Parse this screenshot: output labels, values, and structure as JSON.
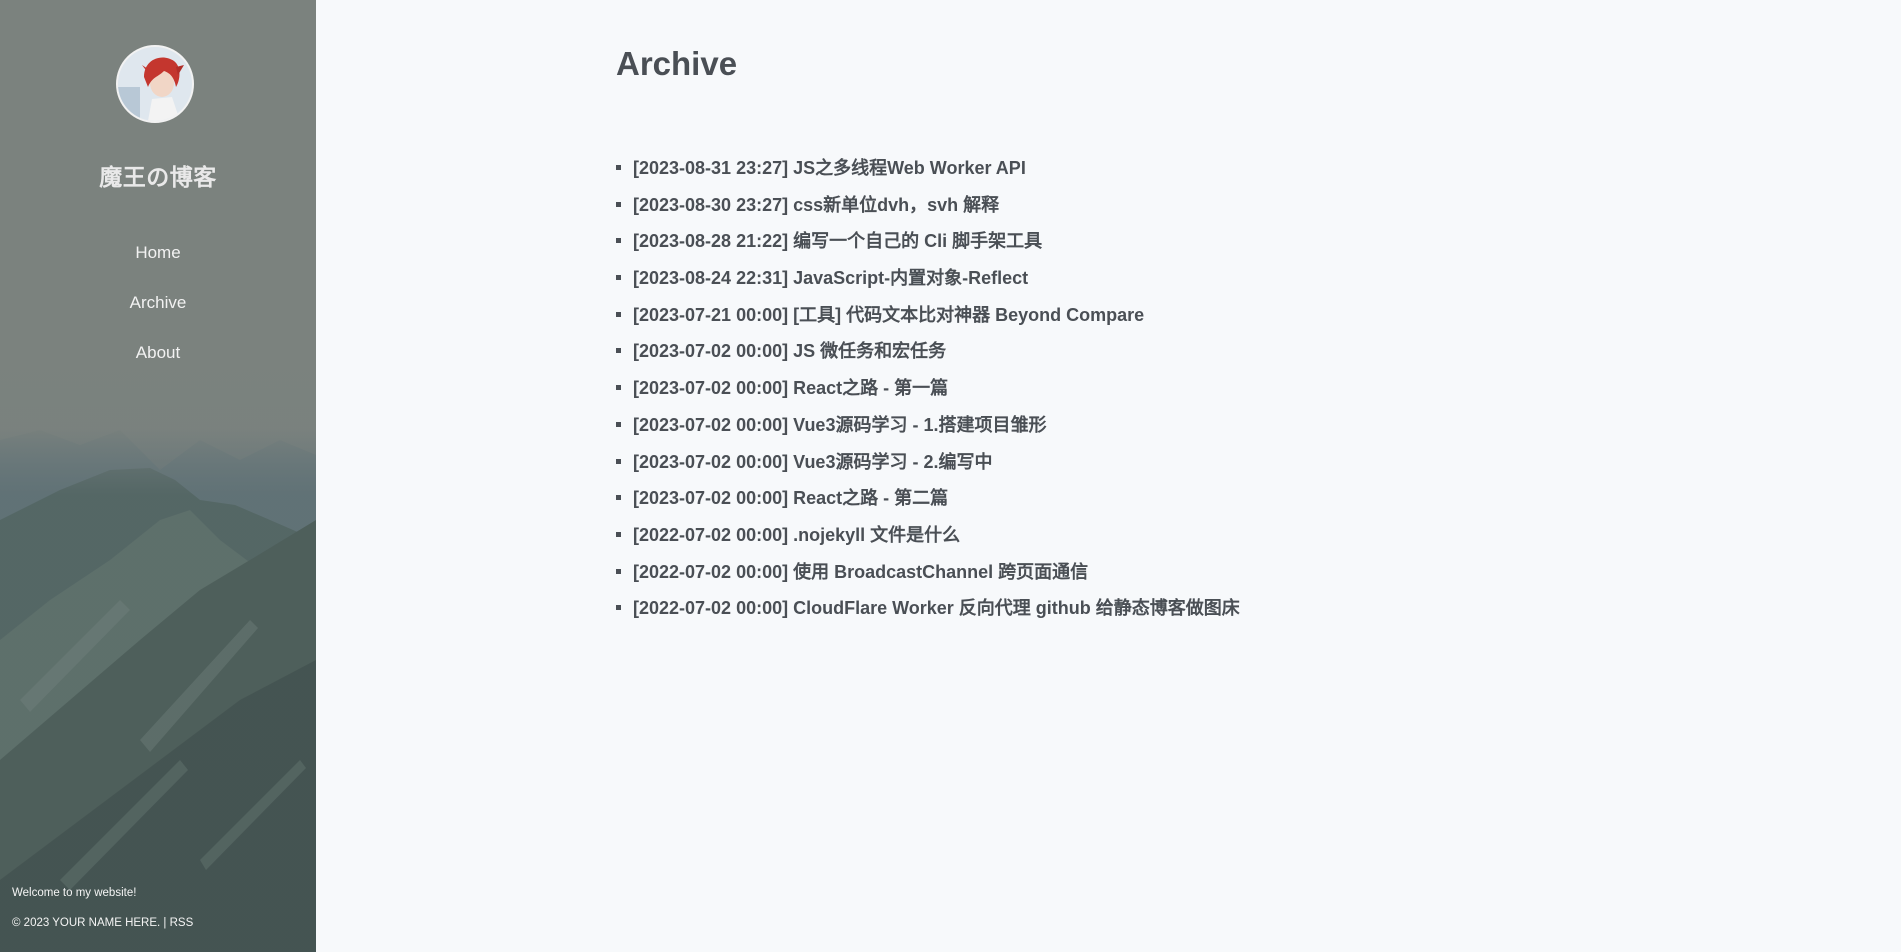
{
  "sidebar": {
    "site_title": "魔王の博客",
    "nav": [
      {
        "label": "Home"
      },
      {
        "label": "Archive"
      },
      {
        "label": "About"
      }
    ],
    "welcome": "Welcome to my website!",
    "copyright": "© 2023 YOUR NAME HERE. | ",
    "rss_label": "RSS"
  },
  "main": {
    "title": "Archive",
    "posts": [
      {
        "text": "[2023-08-31 23:27] JS之多线程Web Worker API"
      },
      {
        "text": "[2023-08-30 23:27] css新单位dvh，svh 解释"
      },
      {
        "text": "[2023-08-28 21:22] 编写一个自己的 Cli 脚手架工具"
      },
      {
        "text": "[2023-08-24 22:31] JavaScript-内置对象-Reflect"
      },
      {
        "text": "[2023-07-21 00:00] [工具] 代码文本比对神器 Beyond Compare"
      },
      {
        "text": "[2023-07-02 00:00] JS 微任务和宏任务"
      },
      {
        "text": "[2023-07-02 00:00] React之路 - 第一篇"
      },
      {
        "text": "[2023-07-02 00:00] Vue3源码学习 - 1.搭建项目雏形"
      },
      {
        "text": "[2023-07-02 00:00] Vue3源码学习 - 2.编写中"
      },
      {
        "text": "[2023-07-02 00:00] React之路 - 第二篇"
      },
      {
        "text": "[2022-07-02 00:00] .nojekyll 文件是什么"
      },
      {
        "text": "[2022-07-02 00:00] 使用 BroadcastChannel 跨页面通信"
      },
      {
        "text": "[2022-07-02 00:00] CloudFlare Worker 反向代理 github 给静态博客做图床"
      }
    ]
  }
}
